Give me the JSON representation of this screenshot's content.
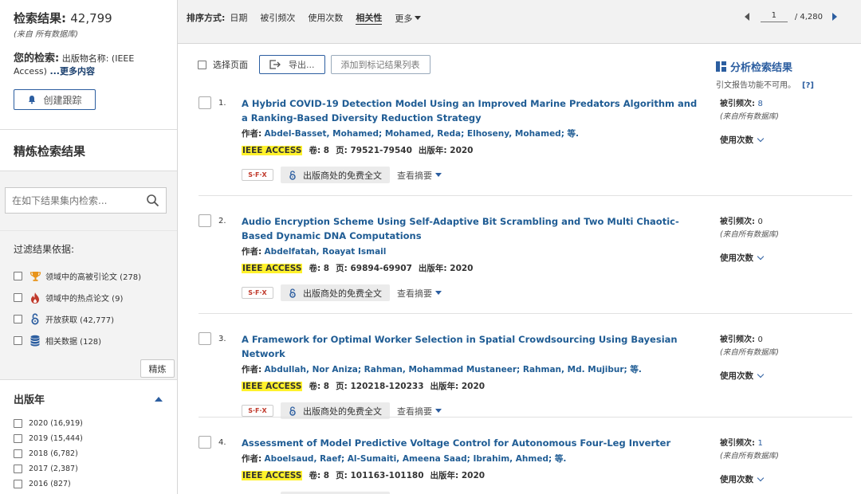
{
  "sidebar": {
    "results_label": "检索结果:",
    "results_count": "42,799",
    "results_sub": "(来自 所有数据库)",
    "your_search_label": "您的检索:",
    "query_text": "出版物名称: (IEEE Access)",
    "more_link": "...更多内容",
    "alert_button": "创建跟踪",
    "refine_title": "精炼检索结果",
    "search_placeholder": "在如下结果集内检索...",
    "filter_title": "过滤结果依据:",
    "filters": [
      {
        "icon": "trophy-icon",
        "label": "领域中的高被引论文 (278)"
      },
      {
        "icon": "fire-icon",
        "label": "领域中的热点论文 (9)"
      },
      {
        "icon": "open-access-icon",
        "label": "开放获取 (42,777)"
      },
      {
        "icon": "database-icon",
        "label": "相关数据 (128)"
      }
    ],
    "refine_button": "精炼",
    "year_title": "出版年",
    "years": [
      "2020 (16,919)",
      "2019 (15,444)",
      "2018 (6,782)",
      "2017 (2,387)",
      "2016 (827)"
    ]
  },
  "topbar": {
    "sort_label": "排序方式:",
    "sort_options": [
      "日期",
      "被引频次",
      "使用次数",
      "相关性"
    ],
    "sort_more": "更多",
    "page_value": "1",
    "page_total": "/ 4,280"
  },
  "actions": {
    "select_page": "选择页面",
    "export_button": "导出...",
    "mark_button": "添加到标记结果列表"
  },
  "analyze": {
    "title": "分析检索结果",
    "sub": "引文报告功能不可用。",
    "help": "[?]"
  },
  "common": {
    "authors_label": "作者:",
    "vol_label": "卷: 8",
    "sfx_label": "S·F·X",
    "fulltext_label": "出版商处的免费全文",
    "abstract_label": "查看摘要",
    "cited_label": "被引频次:",
    "cited_sub": "(来自所有数据库)",
    "usage_label": "使用次数"
  },
  "records": [
    {
      "no": "1.",
      "title": "A Hybrid COVID-19 Detection Model Using an Improved Marine Predators Algorithm and a Ranking-Based Diversity Reduction Strategy",
      "authors": "Abdel-Basset, Mohamed; Mohamed, Reda; Elhoseny, Mohamed; 等.",
      "journal": "IEEE ACCESS",
      "pages": "页: 79521-79540",
      "year": "出版年: 2020",
      "cited": "8"
    },
    {
      "no": "2.",
      "title": "Audio Encryption Scheme Using Self-Adaptive Bit Scrambling and Two Multi Chaotic-Based Dynamic DNA Computations",
      "authors": "Abdelfatah, Roayat Ismail",
      "journal": "IEEE ACCESS",
      "pages": "页: 69894-69907",
      "year": "出版年: 2020",
      "cited": "0"
    },
    {
      "no": "3.",
      "title": "A Framework for Optimal Worker Selection in Spatial Crowdsourcing Using Bayesian Network",
      "authors": "Abdullah, Nor Aniza; Rahman, Mohammad Mustaneer; Rahman, Md. Mujibur; 等.",
      "journal": "IEEE ACCESS",
      "pages": "页: 120218-120233",
      "year": "出版年: 2020",
      "cited": "0"
    },
    {
      "no": "4.",
      "title": "Assessment of Model Predictive Voltage Control for Autonomous Four-Leg Inverter",
      "authors": "Aboelsaud, Raef; Al-Sumaiti, Ameena Saad; Ibrahim, Ahmed; 等.",
      "journal": "IEEE ACCESS",
      "pages": "页: 101163-101180",
      "year": "出版年: 2020",
      "cited": "1"
    }
  ]
}
